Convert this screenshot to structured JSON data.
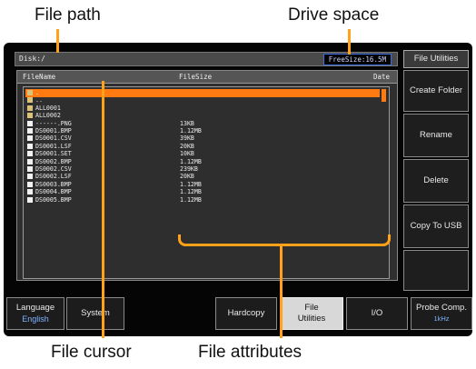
{
  "callouts": {
    "file_path": "File path",
    "drive_space": "Drive space",
    "file_cursor": "File cursor",
    "file_attributes": "File attributes"
  },
  "screen": {
    "path": "Disk:/",
    "free_size": "FreeSize:16.5M",
    "columns": {
      "name": "FileName",
      "size": "FileSize",
      "date": "Date"
    },
    "files": [
      {
        "name": ".",
        "size": "",
        "type": "folder",
        "selected": true
      },
      {
        "name": "..",
        "size": "",
        "type": "folder"
      },
      {
        "name": "ALL0001",
        "size": "",
        "type": "folder"
      },
      {
        "name": "ALL0002",
        "size": "",
        "type": "folder"
      },
      {
        "name": "------.PNG",
        "size": "13KB",
        "type": "file"
      },
      {
        "name": "DS0001.BMP",
        "size": "1.12MB",
        "type": "file"
      },
      {
        "name": "DS0001.CSV",
        "size": "39KB",
        "type": "file"
      },
      {
        "name": "DS0001.LSF",
        "size": "20KB",
        "type": "file"
      },
      {
        "name": "DS0001.SET",
        "size": "10KB",
        "type": "file"
      },
      {
        "name": "DS0002.BMP",
        "size": "1.12MB",
        "type": "file"
      },
      {
        "name": "DS0002.CSV",
        "size": "239KB",
        "type": "file"
      },
      {
        "name": "DS0002.LSF",
        "size": "20KB",
        "type": "file"
      },
      {
        "name": "DS0003.BMP",
        "size": "1.12MB",
        "type": "file"
      },
      {
        "name": "DS0004.BMP",
        "size": "1.12MB",
        "type": "file"
      },
      {
        "name": "DS0005.BMP",
        "size": "1.12MB",
        "type": "file"
      }
    ]
  },
  "side_menu": {
    "title": "File Utilities",
    "create_folder": "Create Folder",
    "rename": "Rename",
    "delete": "Delete",
    "copy_to_usb": "Copy To USB"
  },
  "bottom_menu": {
    "language": "Language",
    "language_value": "English",
    "system": "System",
    "hardcopy": "Hardcopy",
    "file_utilities": "File Utilities",
    "io": "I/O",
    "probe_comp": "Probe Comp.",
    "probe_comp_value": "1kHz"
  },
  "colors": {
    "accent": "#ffa21a",
    "cursor": "#ff7a10",
    "blue_text": "#7fb2ff"
  }
}
